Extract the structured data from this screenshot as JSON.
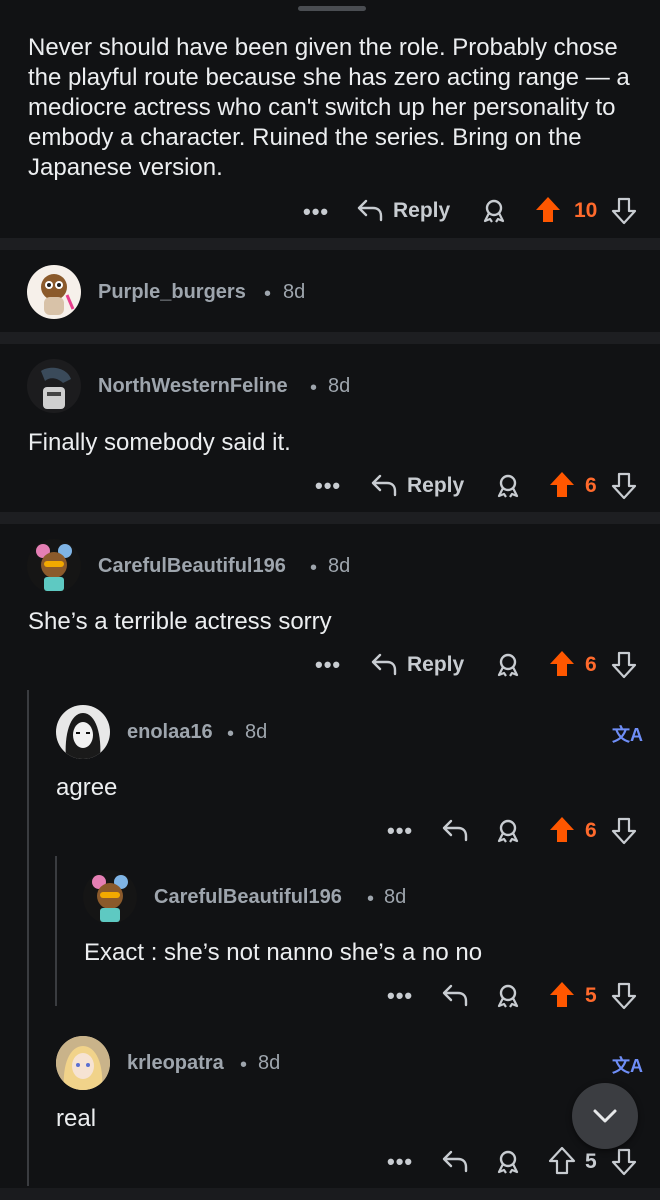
{
  "comments": [
    {
      "text": "Never should have been given the role. Probably chose the playful route because she has zero acting range — a mediocre actress who can't switch up her personality to embody a character. Ruined the series. Bring on the Japanese version.",
      "reply_label": "Reply",
      "votes": "10"
    },
    {
      "username": "Purple_burgers",
      "time": "8d"
    },
    {
      "username": "NorthWesternFeline",
      "time": "8d",
      "text": "Finally somebody said it.",
      "reply_label": "Reply",
      "votes": "6"
    },
    {
      "username": "CarefulBeautiful196",
      "time": "8d",
      "text": "She’s a terrible actress sorry",
      "reply_label": "Reply",
      "votes": "6"
    },
    {
      "username": "enolaa16",
      "time": "8d",
      "text": "agree",
      "votes": "6"
    },
    {
      "username": "CarefulBeautiful196",
      "time": "8d",
      "text": "Exact : she’s not nanno she’s a no no",
      "votes": "5"
    },
    {
      "username": "krleopatra",
      "time": "8d",
      "text": "real",
      "votes": "5"
    }
  ],
  "dot_separator": "•",
  "more_label": "•••",
  "translate_label": "文A",
  "colors": {
    "upvote": "#ff5700",
    "translate": "#6f8ef7",
    "background": "#111214"
  }
}
